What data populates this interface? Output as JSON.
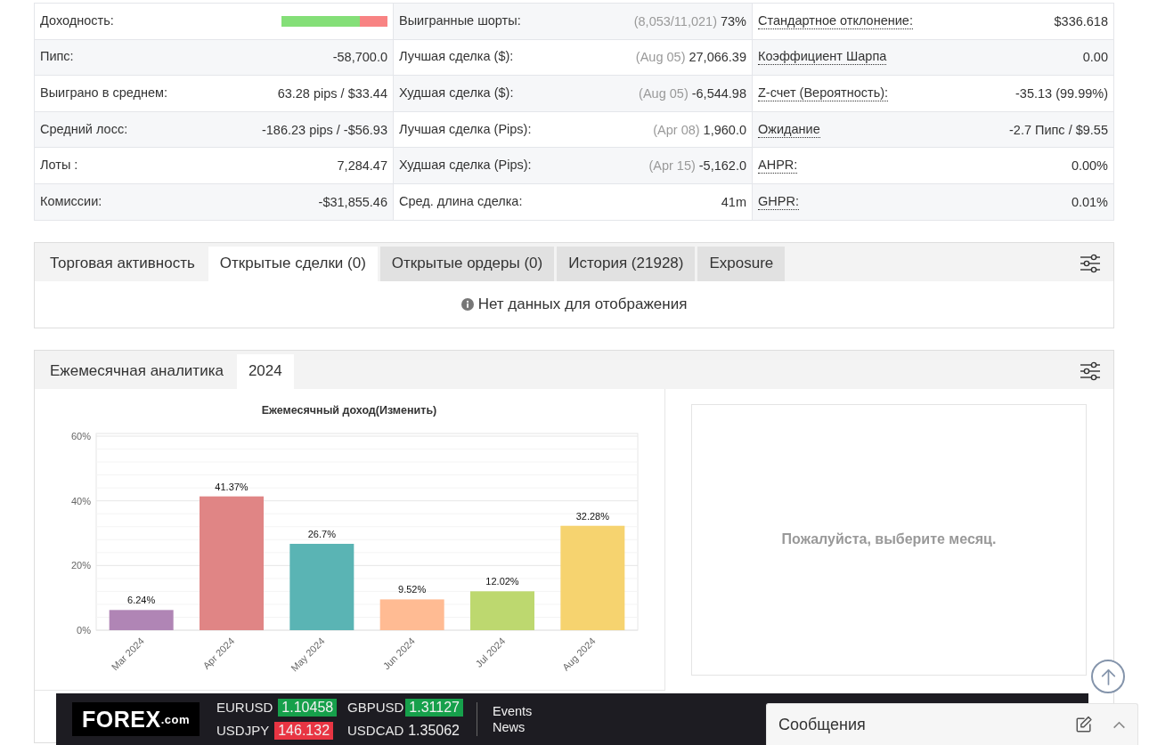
{
  "stats": {
    "columns": [
      {
        "rows": [
          {
            "kind": "meter",
            "label": "Доходность:",
            "tooltip": false,
            "level": 0.74
          },
          {
            "kind": "value",
            "label": "Пипс:",
            "tooltip": false,
            "value": "-58,700.0"
          },
          {
            "kind": "value",
            "label": "Выиграно в среднем:",
            "tooltip": false,
            "value": "63.28 pips / $33.44"
          },
          {
            "kind": "value",
            "label": "Средний лосс:",
            "tooltip": false,
            "value": "-186.23 pips / -$56.93"
          },
          {
            "kind": "value",
            "label": "Лоты :",
            "tooltip": false,
            "value": "7,284.47"
          },
          {
            "kind": "value",
            "label": "Комиссии:",
            "tooltip": false,
            "value": "-$31,855.46"
          }
        ]
      },
      {
        "rows": [
          {
            "kind": "value",
            "label": "Выигранные шорты:",
            "tooltip": false,
            "note": "(8,053/11,021)",
            "value": "73%"
          },
          {
            "kind": "value",
            "label": "Лучшая сделка ($):",
            "tooltip": false,
            "note": "(Aug 05)",
            "value": "27,066.39"
          },
          {
            "kind": "value",
            "label": "Худшая сделка ($):",
            "tooltip": false,
            "note": "(Aug 05)",
            "value": "-6,544.98"
          },
          {
            "kind": "value",
            "label": "Лучшая сделка (Pips):",
            "tooltip": false,
            "note": "(Apr 08)",
            "value": "1,960.0"
          },
          {
            "kind": "value",
            "label": "Худшая сделка (Pips):",
            "tooltip": false,
            "note": "(Apr 15)",
            "value": "-5,162.0"
          },
          {
            "kind": "value",
            "label": "Сред. длина сделка:",
            "tooltip": false,
            "value": "41m"
          }
        ]
      },
      {
        "rows": [
          {
            "kind": "value",
            "label": "Стандартное отклонение:",
            "tooltip": true,
            "value": "$336.618"
          },
          {
            "kind": "value",
            "label": "Коэффициент Шарпа",
            "tooltip": true,
            "value": "0.00"
          },
          {
            "kind": "value",
            "label": "Z-счет (Вероятность):",
            "tooltip": true,
            "value": "-35.13 (99.99%)"
          },
          {
            "kind": "value",
            "label": "Ожидание",
            "tooltip": true,
            "value": "-2.7 Пипс / $9.55"
          },
          {
            "kind": "value",
            "label": "AHPR:",
            "tooltip": true,
            "value": "0.00%"
          },
          {
            "kind": "value",
            "label": "GHPR:",
            "tooltip": true,
            "value": "0.01%"
          }
        ]
      }
    ]
  },
  "trading_panel": {
    "title": "Торговая активность",
    "tabs": [
      {
        "label": "Открытые сделки (0)",
        "selected": true
      },
      {
        "label": "Открытые ордеры (0)",
        "selected": false
      },
      {
        "label": "История (21928)",
        "selected": false
      },
      {
        "label": "Exposure",
        "selected": false
      }
    ],
    "empty_message": "Нет данных для отображения"
  },
  "monthly_panel": {
    "title": "Ежемесячная аналитика",
    "tabs": [
      {
        "label": "2024",
        "selected": true
      }
    ],
    "chart_data": [
      {
        "type": "bar",
        "title": "Ежемесячный доход(Изменить)",
        "categories": [
          "Mar 2024",
          "Apr 2024",
          "May 2024",
          "Jun 2024",
          "Jul 2024",
          "Aug 2024"
        ],
        "values": [
          6.24,
          41.37,
          26.7,
          9.52,
          12.02,
          32.28
        ],
        "colors": [
          "#b085b5",
          "#e08585",
          "#5ab4b4",
          "#ffbb93",
          "#bdd86f",
          "#f6d36f"
        ],
        "value_labels": [
          "6.24%",
          "41.37%",
          "26.7%",
          "9.52%",
          "12.02%",
          "32.28%"
        ],
        "ylim": [
          0,
          60
        ],
        "yticks": [
          {
            "value": 0,
            "label": "0%"
          },
          {
            "value": 20,
            "label": "20%"
          },
          {
            "value": 40,
            "label": "40%"
          },
          {
            "value": 60,
            "label": "60%"
          }
        ],
        "grid": true
      }
    ],
    "empty_message": "Пожалуйста, выберите месяц."
  },
  "ticker_bar": {
    "logo": {
      "name": "FOREX",
      "suffix": ".com"
    },
    "quotes": [
      {
        "symbol": "EURUSD",
        "price": "1.10458",
        "color": "#16a04b"
      },
      {
        "symbol": "USDJPY",
        "price": "146.132",
        "color": "#e83543"
      },
      {
        "symbol": "GBPUSD",
        "price": "1.31127",
        "color": "#16a04b"
      },
      {
        "symbol": "USDCAD",
        "price": "1.35062"
      }
    ],
    "links": [
      "Events",
      "News"
    ]
  },
  "messages_panel": {
    "title": "Сообщения"
  }
}
